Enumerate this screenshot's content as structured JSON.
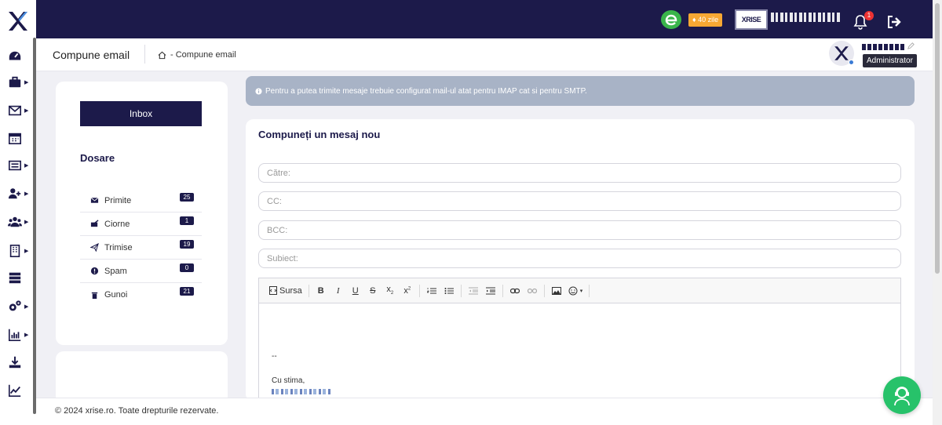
{
  "topbar": {
    "trial_badge": "40 zile",
    "company_logo_text": "XRISE",
    "notifications_count": "1"
  },
  "breadcrumb": {
    "page_title": "Compune email",
    "trail": "- Compune email"
  },
  "user": {
    "role": "Administrator"
  },
  "folders": {
    "inbox_label": "Inbox",
    "heading": "Dosare",
    "items": [
      {
        "label": "Primite",
        "count": "25"
      },
      {
        "label": "Ciorne",
        "count": "1"
      },
      {
        "label": "Trimise",
        "count": "19"
      },
      {
        "label": "Spam",
        "count": "0"
      },
      {
        "label": "Gunoi",
        "count": "21"
      }
    ]
  },
  "alert": {
    "text": "Pentru a putea trimite mesaje trebuie configurat mail-ul atat pentru IMAP cat si pentru SMTP."
  },
  "compose": {
    "title": "Compuneți un mesaj nou",
    "to_placeholder": "Către:",
    "cc_placeholder": "CC:",
    "bcc_placeholder": "BCC:",
    "subject_placeholder": "Subiect:",
    "source_label": "Sursa",
    "signature_dash": "--",
    "signature_text": "Cu stima,"
  },
  "footer": {
    "text": "© 2024 xrise.ro. Toate drepturile rezervate."
  },
  "colors": {
    "navy": "#1c1a4a",
    "alert_bg": "#a8b3c6",
    "trial_orange": "#f7a833",
    "support_green": "#27c26a"
  }
}
